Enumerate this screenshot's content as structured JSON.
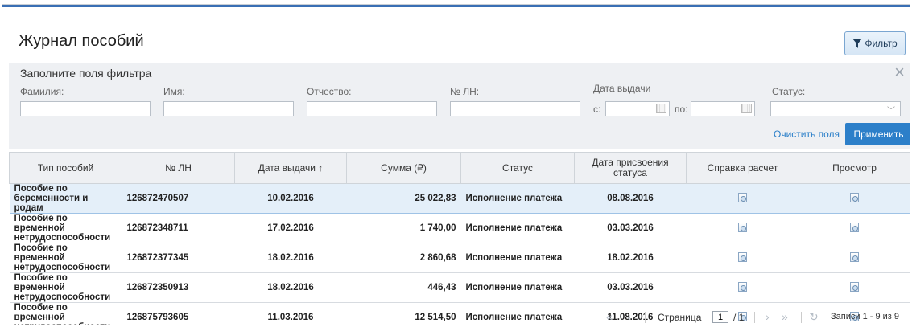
{
  "page": {
    "title": "Журнал пособий",
    "filter_button": "Фильтр"
  },
  "filter": {
    "title": "Заполните поля фильтра",
    "labels": {
      "last_name": "Фамилия:",
      "first_name": "Имя:",
      "middle_name": "Отчество:",
      "ln_number": "№ ЛН:",
      "issue_date": "Дата выдачи",
      "from": "с:",
      "to": "по:",
      "status": "Статус:"
    },
    "values": {
      "last_name": "",
      "first_name": "",
      "middle_name": "",
      "ln_number": "",
      "date_from": "",
      "date_to": "",
      "status": ""
    },
    "clear_label": "Очистить поля",
    "apply_label": "Применить"
  },
  "table": {
    "headers": {
      "type": "Тип пособий",
      "ln": "№ ЛН",
      "issue_date": "Дата выдачи ↑",
      "sum": "Сумма (₽)",
      "status": "Статус",
      "status_date": "Дата присвоения статуса",
      "calc": "Справка расчет",
      "view": "Просмотр"
    },
    "rows": [
      {
        "type": "Пособие по беременности и родам",
        "ln": "126872470507",
        "issue_date": "10.02.2016",
        "sum": "25 022,83",
        "status": "Исполнение платежа",
        "status_date": "08.08.2016"
      },
      {
        "type": "Пособие по временной нетрудоспособности",
        "ln": "126872348711",
        "issue_date": "17.02.2016",
        "sum": "1 740,00",
        "status": "Исполнение платежа",
        "status_date": "03.03.2016"
      },
      {
        "type": "Пособие по временной нетрудоспособности",
        "ln": "126872377345",
        "issue_date": "18.02.2016",
        "sum": "2 860,68",
        "status": "Исполнение платежа",
        "status_date": "18.02.2016"
      },
      {
        "type": "Пособие по временной нетрудоспособности",
        "ln": "126872350913",
        "issue_date": "18.02.2016",
        "sum": "446,43",
        "status": "Исполнение платежа",
        "status_date": "03.03.2016"
      },
      {
        "type": "Пособие по временной нетрудоспособности",
        "ln": "126875793605",
        "issue_date": "11.03.2016",
        "sum": "12 514,50",
        "status": "Исполнение платежа",
        "status_date": "11.08.2016"
      }
    ]
  },
  "pager": {
    "page_label": "Страница",
    "current_page": "1",
    "total_pages": "/ 1",
    "records": "Записи 1 - 9 из 9"
  },
  "colors": {
    "accent": "#2c7fc9",
    "selected_row": "#e4eff9",
    "header_bg": "#eef0f3"
  },
  "icons": [
    "filter-icon",
    "close-icon",
    "calendar-icon",
    "chevron-down-icon",
    "document-icon",
    "first-page-icon",
    "prev-page-icon",
    "next-page-icon",
    "last-page-icon",
    "refresh-icon"
  ]
}
